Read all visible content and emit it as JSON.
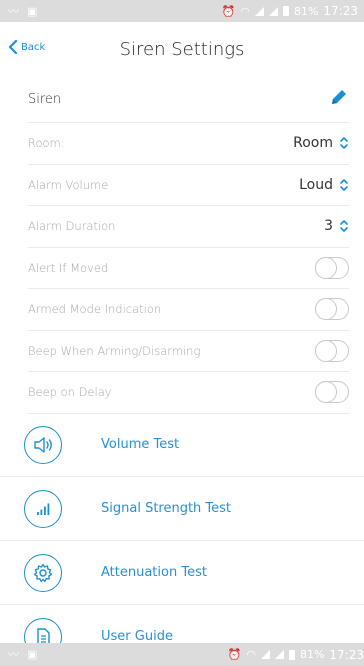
{
  "status_bar": {
    "battery": "81%",
    "time": "17:23"
  },
  "nav": {
    "back_label": "Back",
    "title": "Siren Settings"
  },
  "device_name": "Siren",
  "settings": [
    {
      "label": "Room:",
      "value": "Room",
      "control": "picker"
    },
    {
      "label": "Alarm Volume",
      "value": "Loud",
      "control": "picker"
    },
    {
      "label": "Alarm Duration",
      "value": "3",
      "control": "picker"
    },
    {
      "label": "Alert If Moved",
      "control": "toggle",
      "on": false
    },
    {
      "label": "Armed Mode Indication",
      "control": "toggle",
      "on": false
    },
    {
      "label": "Beep When Arming/Disarming",
      "control": "toggle",
      "on": false
    },
    {
      "label": "Beep on Delay",
      "control": "toggle",
      "on": false
    }
  ],
  "actions": [
    {
      "label": "Volume Test",
      "icon": "speaker-icon"
    },
    {
      "label": "Signal Strength Test",
      "icon": "signal-bars-icon"
    },
    {
      "label": "Attenuation Test",
      "icon": "gear-icon"
    },
    {
      "label": "User Guide",
      "icon": "document-icon"
    }
  ],
  "colors": {
    "accent": "#1a8fd6",
    "status_bar": "#dcdcdc"
  }
}
